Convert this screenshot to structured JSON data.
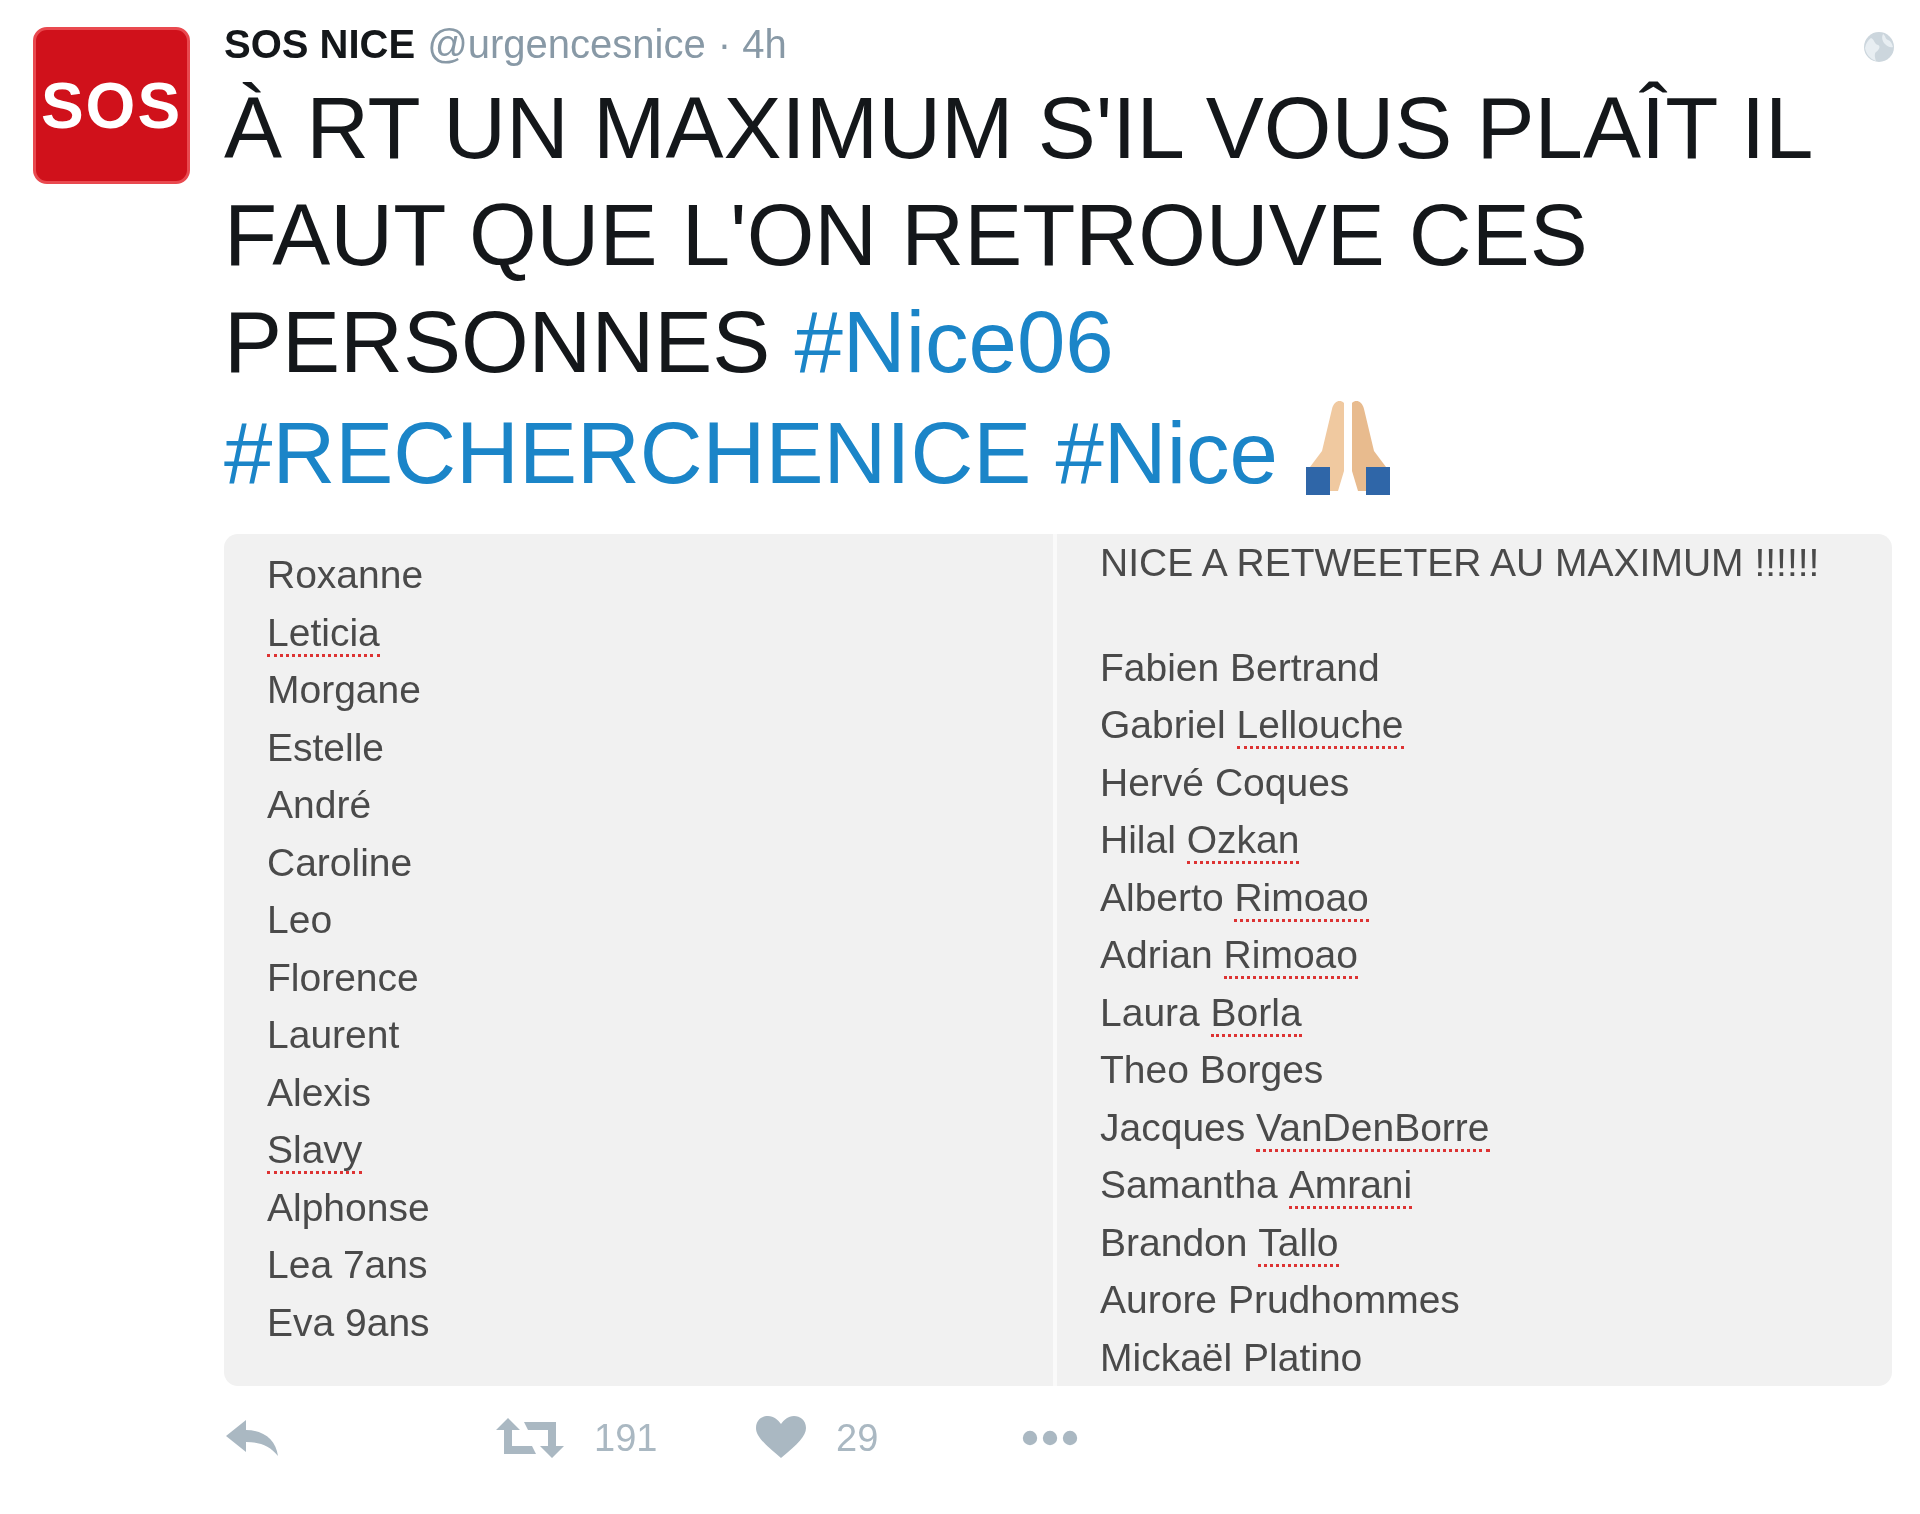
{
  "tweet": {
    "author": {
      "avatar_text": "SOS",
      "name": "SOS NICE",
      "handle": "@urgencesnice",
      "time": "· 4h"
    },
    "text": [
      {
        "kind": "plain",
        "text": "À RT UN MAXIMUM S'IL VOUS PLAÎT IL FAUT QUE L'ON RETROUVE CES PERSONNES"
      },
      {
        "kind": "hashtag",
        "text": "#Nice06"
      },
      {
        "kind": "hashtag",
        "text": "#RECHERCHENICE"
      },
      {
        "kind": "hashtag",
        "text": "#Nice"
      },
      {
        "kind": "emoji"
      }
    ],
    "image": {
      "columns": [
        {
          "names": [
            {
              "words": [
                {
                  "w": "Roxanne",
                  "flagged": false
                }
              ]
            },
            {
              "words": [
                {
                  "w": "Leticia",
                  "flagged": true
                }
              ]
            },
            {
              "words": [
                {
                  "w": "Morgane",
                  "flagged": false
                }
              ]
            },
            {
              "words": [
                {
                  "w": "Estelle",
                  "flagged": false
                }
              ]
            },
            {
              "words": [
                {
                  "w": "André",
                  "flagged": false
                }
              ]
            },
            {
              "words": [
                {
                  "w": "Caroline",
                  "flagged": false
                }
              ]
            },
            {
              "words": [
                {
                  "w": "Leo",
                  "flagged": false
                }
              ]
            },
            {
              "words": [
                {
                  "w": "Florence",
                  "flagged": false
                }
              ]
            },
            {
              "words": [
                {
                  "w": "Laurent",
                  "flagged": false
                }
              ]
            },
            {
              "words": [
                {
                  "w": "Alexis",
                  "flagged": false
                }
              ]
            },
            {
              "words": [
                {
                  "w": "Slavy",
                  "flagged": true
                }
              ]
            },
            {
              "words": [
                {
                  "w": "Alphonse",
                  "flagged": false
                }
              ]
            },
            {
              "words": [
                {
                  "w": "Lea",
                  "flagged": false
                },
                {
                  "w": "7ans",
                  "flagged": false
                }
              ]
            },
            {
              "words": [
                {
                  "w": "Eva",
                  "flagged": false
                },
                {
                  "w": "9ans",
                  "flagged": false
                }
              ]
            }
          ]
        },
        {
          "heading": "NICE A RETWEETER AU MAXIMUM !!!!!!",
          "names": [
            {
              "words": [
                {
                  "w": "Fabien",
                  "flagged": false
                },
                {
                  "w": "Bertrand",
                  "flagged": false
                }
              ]
            },
            {
              "words": [
                {
                  "w": "Gabriel",
                  "flagged": false
                },
                {
                  "w": "Lellouche",
                  "flagged": true
                }
              ]
            },
            {
              "words": [
                {
                  "w": "Hervé",
                  "flagged": false
                },
                {
                  "w": "Coques",
                  "flagged": false
                }
              ]
            },
            {
              "words": [
                {
                  "w": "Hilal",
                  "flagged": false
                },
                {
                  "w": "Ozkan",
                  "flagged": true
                }
              ]
            },
            {
              "words": [
                {
                  "w": "Alberto",
                  "flagged": false
                },
                {
                  "w": "Rimoao",
                  "flagged": true
                }
              ]
            },
            {
              "words": [
                {
                  "w": "Adrian",
                  "flagged": false
                },
                {
                  "w": "Rimoao",
                  "flagged": true
                }
              ]
            },
            {
              "words": [
                {
                  "w": "Laura",
                  "flagged": false
                },
                {
                  "w": "Borla",
                  "flagged": true
                }
              ]
            },
            {
              "words": [
                {
                  "w": "Theo",
                  "flagged": false
                },
                {
                  "w": "Borges",
                  "flagged": false
                }
              ]
            },
            {
              "words": [
                {
                  "w": "Jacques",
                  "flagged": false
                },
                {
                  "w": "VanDenBorre",
                  "flagged": true
                }
              ]
            },
            {
              "words": [
                {
                  "w": "Samantha",
                  "flagged": false
                },
                {
                  "w": "Amrani",
                  "flagged": true
                }
              ]
            },
            {
              "words": [
                {
                  "w": "Brandon",
                  "flagged": false
                },
                {
                  "w": "Tallo",
                  "flagged": true
                }
              ]
            },
            {
              "words": [
                {
                  "w": "Aurore",
                  "flagged": false
                },
                {
                  "w": "Prudhommes",
                  "flagged": false
                }
              ]
            },
            {
              "words": [
                {
                  "w": "Mickaël",
                  "flagged": false
                },
                {
                  "w": "Platino",
                  "flagged": false
                }
              ]
            }
          ]
        }
      ]
    },
    "actions": [
      {
        "kind": "reply"
      },
      {
        "kind": "retweet",
        "count": "191"
      },
      {
        "kind": "like",
        "count": "29"
      },
      {
        "kind": "more"
      }
    ]
  }
}
